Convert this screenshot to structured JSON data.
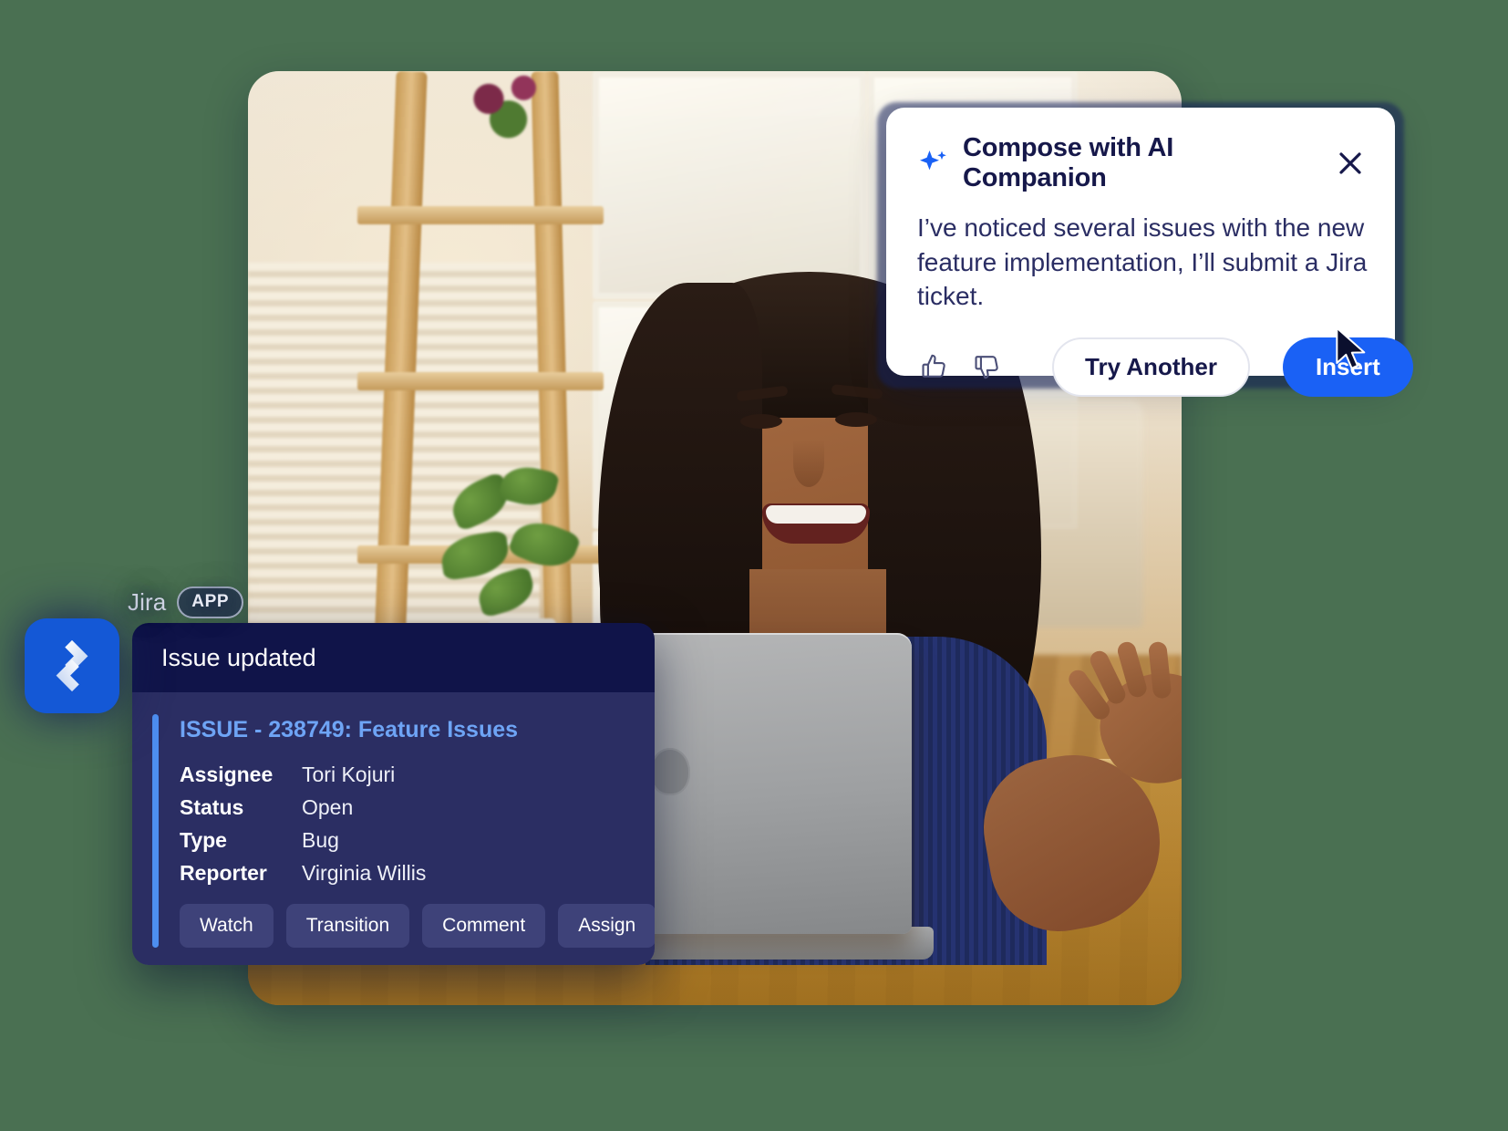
{
  "background": {
    "color": "#4a7052"
  },
  "photo": {
    "alt_description": "Smiling woman with long dark hair wearing a navy sleeveless top and beaded necklace, sitting at a wooden desk looking at an open silver laptop in a bright room with a wooden shelf ladder, plants and french-door windows."
  },
  "ai_card": {
    "sparkle_icon": "sparkle-icon",
    "title": "Compose with AI Companion",
    "close_icon": "close-icon",
    "message": "I’ve noticed several issues with the new feature implementation, I’ll submit a Jira ticket.",
    "thumbs_up_icon": "thumbs-up-icon",
    "thumbs_down_icon": "thumbs-down-icon",
    "try_another_label": "Try Another",
    "insert_label": "Insert",
    "accent_color": "#1a61f5",
    "title_color": "#16184a",
    "body_color": "#2a2d63",
    "cursor_icon": "mouse-cursor-icon"
  },
  "jira": {
    "app_name": "Jira",
    "app_badge": "APP",
    "logo_icon": "jira-logo-icon",
    "logo_color": "#1458d6",
    "header_title": "Issue updated",
    "header_color": "#101449",
    "body_color": "#2b2e63",
    "accent_bar_color": "#4d8ef0",
    "issue_link": "ISSUE - 238749: Feature Issues",
    "issue_link_color": "#6ea4f5",
    "fields": [
      {
        "label": "Assignee",
        "value": "Tori Kojuri"
      },
      {
        "label": "Status",
        "value": "Open"
      },
      {
        "label": "Type",
        "value": "Bug"
      },
      {
        "label": "Reporter",
        "value": "Virginia Willis"
      }
    ],
    "actions": [
      "Watch",
      "Transition",
      "Comment",
      "Assign"
    ]
  }
}
